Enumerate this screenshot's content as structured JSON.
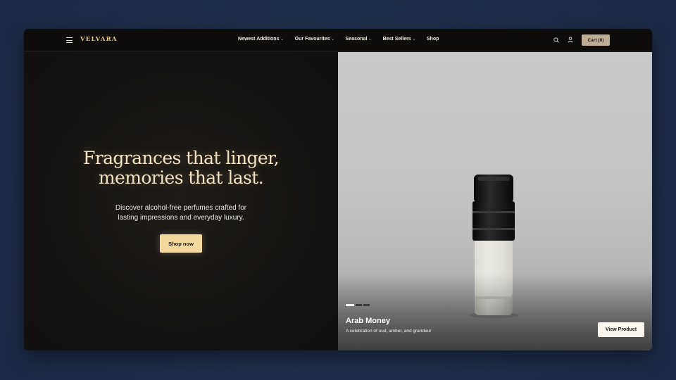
{
  "nav": {
    "brand": "VELVARA",
    "menu": [
      {
        "label": "Newest Additions",
        "has_dropdown": true
      },
      {
        "label": "Our Favourites",
        "has_dropdown": true
      },
      {
        "label": "Seasonal",
        "has_dropdown": true
      },
      {
        "label": "Best Sellers",
        "has_dropdown": true
      },
      {
        "label": "Shop",
        "has_dropdown": false
      }
    ],
    "icons": [
      "menu-icon",
      "search-icon",
      "user-icon"
    ],
    "cart_label": "Cart (0)"
  },
  "hero": {
    "headline_line1": "Fragrances that linger,",
    "headline_line2": "memories that last.",
    "subtext_line1": "Discover alcohol-free perfumes crafted for",
    "subtext_line2": "lasting impressions and everyday luxury.",
    "cta_label": "Shop now"
  },
  "product": {
    "name": "Arab Money",
    "description": "A celebration of oud, amber, and grandeur",
    "button_label": "View Product",
    "slide_count": 3,
    "active_slide": 1
  },
  "colors": {
    "accent": "#f4d99e",
    "brand": "#e9c98a",
    "cart_bg": "#bfae95",
    "page_bg": "#1f2d4b",
    "hero_bg": "#151311"
  }
}
